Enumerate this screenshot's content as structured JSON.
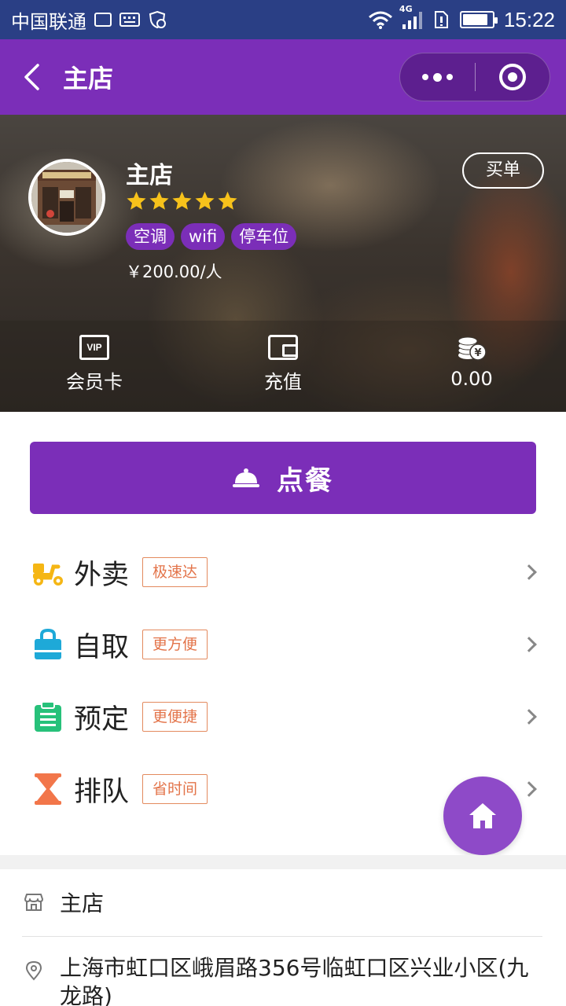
{
  "status_bar": {
    "carrier": "中国联通",
    "network": "4G",
    "time": "15:22",
    "battery_level": 0.85
  },
  "nav": {
    "title": "主店"
  },
  "store": {
    "name": "主店",
    "rating": 5,
    "rating_max": 5,
    "tags": [
      "空调",
      "wifi",
      "停车位"
    ],
    "price": "￥200.00/人",
    "pay_button": "买单"
  },
  "quick_links": [
    {
      "icon": "vip-card-icon",
      "label": "会员卡"
    },
    {
      "icon": "wallet-icon",
      "label": "充值"
    },
    {
      "icon": "coins-icon",
      "label": "0.00"
    }
  ],
  "order_button": {
    "label": "点餐",
    "icon": "serving-cloche-icon"
  },
  "services": [
    {
      "icon": "scooter-icon",
      "label": "外卖",
      "badge": "极速达",
      "color": "#f5b614"
    },
    {
      "icon": "shopping-bag-icon",
      "label": "自取",
      "badge": "更方便",
      "color": "#1ea9d8"
    },
    {
      "icon": "clipboard-icon",
      "label": "预定",
      "badge": "更便捷",
      "color": "#27c17a"
    },
    {
      "icon": "hourglass-icon",
      "label": "排队",
      "badge": "省时间",
      "color": "#f2764a"
    }
  ],
  "store_info": {
    "name": "主店",
    "address": "上海市虹口区峨眉路356号临虹口区兴业小区(九龙路)"
  },
  "colors": {
    "status_bar": "#2a3f85",
    "primary": "#7b2eb8",
    "fab": "#8e4ac8",
    "badge_text": "#e3744a"
  }
}
